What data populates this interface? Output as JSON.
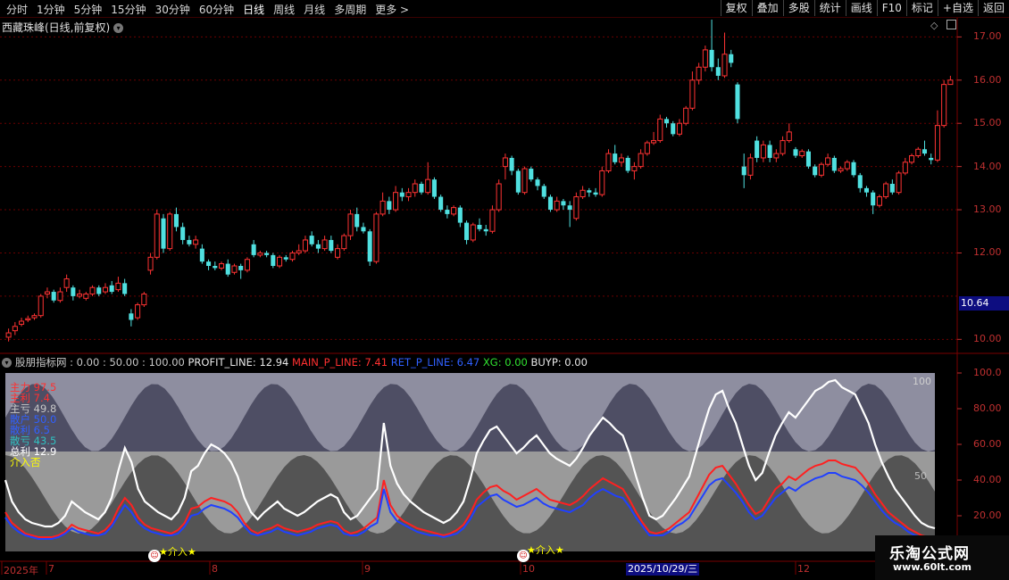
{
  "toolbar": {
    "left": [
      "分时",
      "1分钟",
      "5分钟",
      "15分钟",
      "30分钟",
      "60分钟",
      "日线",
      "周线",
      "月线",
      "多周期",
      "更多 >"
    ],
    "active": "日线",
    "right": [
      "复权",
      "叠加",
      "多股",
      "统计",
      "画线",
      "F10",
      "标记",
      "+自选",
      "返回"
    ]
  },
  "chart_title": "西藏珠峰(日线,前复权)",
  "price_axis": [
    "17.00",
    "16.00",
    "15.00",
    "14.00",
    "13.00",
    "12.00",
    "10.00"
  ],
  "current_price": "10.64",
  "indicator_header": {
    "name": "股朋指标网",
    "params": ": 0.00 : 50.00 : 100.00",
    "items": [
      {
        "text": "PROFIT_LINE: 12.94",
        "color": "#e8e8e8"
      },
      {
        "text": "MAIN_P_LINE: 7.41",
        "color": "#ff3030"
      },
      {
        "text": "RET_P_LINE: 6.47",
        "color": "#3060ff"
      },
      {
        "text": "XG: 0.00",
        "color": "#30e030"
      },
      {
        "text": "BUYP: 0.00",
        "color": "#e8e8e8"
      }
    ]
  },
  "legend": [
    {
      "text": "主力 97.5",
      "color": "#ff3030"
    },
    {
      "text": "主利 7.4",
      "color": "#ff3030"
    },
    {
      "text": "主亏 49.8",
      "color": "#c8c8c8"
    },
    {
      "text": "散户 50.0",
      "color": "#3060ff"
    },
    {
      "text": "散利 6.5",
      "color": "#3060ff"
    },
    {
      "text": "散亏 43.5",
      "color": "#30c0c0"
    },
    {
      "text": "总利 12.9",
      "color": "#ffffff"
    },
    {
      "text": "介入否",
      "color": "#ffff00"
    }
  ],
  "indicator_axis": [
    "100.0",
    "80.00",
    "60.00",
    "40.00",
    "20.00"
  ],
  "indicator_labels": {
    "top": "100",
    "mid": "50"
  },
  "signal_label": "介入",
  "date_axis": [
    "2025年",
    "7",
    "8",
    "9",
    "10",
    "12"
  ],
  "cursor_date": "2025/10/29/三",
  "watermark": {
    "name": "乐淘公式网",
    "url": "www.60lt.com"
  },
  "chart_data": {
    "type": "candlestick",
    "ylim": [
      9.8,
      17.4
    ],
    "candles": [
      [
        10.05,
        10.15,
        10.25,
        9.95
      ],
      [
        10.2,
        10.3,
        10.4,
        10.1
      ],
      [
        10.35,
        10.42,
        10.5,
        10.3
      ],
      [
        10.45,
        10.48,
        10.55,
        10.4
      ],
      [
        10.5,
        10.55,
        10.6,
        10.45
      ],
      [
        10.55,
        11.0,
        11.05,
        10.5
      ],
      [
        11.05,
        11.1,
        11.2,
        10.95
      ],
      [
        11.1,
        10.9,
        11.15,
        10.85
      ],
      [
        10.9,
        11.1,
        11.2,
        10.85
      ],
      [
        11.2,
        11.4,
        11.5,
        11.1
      ],
      [
        11.2,
        11.0,
        11.25,
        10.9
      ],
      [
        11.0,
        11.05,
        11.15,
        10.95
      ],
      [
        10.95,
        11.05,
        11.1,
        10.9
      ],
      [
        11.05,
        11.2,
        11.25,
        11.0
      ],
      [
        11.2,
        11.05,
        11.25,
        11.0
      ],
      [
        11.1,
        11.2,
        11.3,
        11.05
      ],
      [
        11.25,
        11.1,
        11.35,
        11.05
      ],
      [
        11.15,
        11.3,
        11.45,
        11.1
      ],
      [
        11.3,
        11.05,
        11.4,
        11.0
      ],
      [
        10.6,
        10.45,
        10.7,
        10.3
      ],
      [
        10.5,
        10.8,
        10.85,
        10.45
      ],
      [
        10.8,
        11.05,
        11.1,
        10.75
      ],
      [
        11.6,
        11.9,
        12.0,
        11.5
      ],
      [
        11.9,
        12.9,
        13.0,
        11.85
      ],
      [
        12.8,
        12.1,
        12.9,
        12.0
      ],
      [
        12.1,
        12.9,
        12.95,
        12.05
      ],
      [
        12.9,
        12.6,
        13.05,
        12.5
      ],
      [
        12.6,
        12.3,
        12.7,
        12.2
      ],
      [
        12.3,
        12.2,
        12.4,
        12.15
      ],
      [
        12.2,
        12.3,
        12.4,
        12.1
      ],
      [
        12.1,
        11.8,
        12.2,
        11.75
      ],
      [
        11.8,
        11.7,
        11.85,
        11.6
      ],
      [
        11.7,
        11.65,
        11.8,
        11.6
      ],
      [
        11.65,
        11.75,
        11.8,
        11.6
      ],
      [
        11.75,
        11.5,
        11.85,
        11.45
      ],
      [
        11.55,
        11.7,
        11.75,
        11.5
      ],
      [
        11.7,
        11.6,
        11.75,
        11.4
      ],
      [
        11.6,
        11.85,
        11.9,
        11.55
      ],
      [
        12.2,
        11.95,
        12.3,
        11.9
      ],
      [
        11.95,
        12.0,
        12.05,
        11.9
      ],
      [
        12.0,
        11.95,
        12.05,
        11.9
      ],
      [
        11.95,
        11.7,
        12.0,
        11.65
      ],
      [
        11.7,
        11.9,
        11.95,
        11.65
      ],
      [
        11.9,
        11.85,
        11.95,
        11.8
      ],
      [
        11.85,
        12.0,
        12.05,
        11.8
      ],
      [
        12.0,
        12.05,
        12.2,
        11.95
      ],
      [
        12.05,
        12.3,
        12.4,
        12.0
      ],
      [
        12.4,
        12.2,
        12.5,
        12.15
      ],
      [
        12.2,
        12.1,
        12.3,
        12.0
      ],
      [
        12.1,
        12.3,
        12.4,
        12.05
      ],
      [
        12.3,
        12.05,
        12.4,
        12.0
      ],
      [
        11.9,
        12.1,
        12.2,
        11.85
      ],
      [
        12.1,
        12.4,
        12.45,
        12.05
      ],
      [
        12.4,
        12.9,
        13.0,
        12.3
      ],
      [
        12.9,
        12.6,
        13.05,
        12.5
      ],
      [
        12.6,
        12.5,
        12.7,
        12.45
      ],
      [
        12.5,
        11.8,
        12.55,
        11.7
      ],
      [
        11.8,
        12.9,
        12.95,
        11.75
      ],
      [
        12.9,
        13.2,
        13.4,
        12.85
      ],
      [
        13.2,
        13.0,
        13.3,
        12.9
      ],
      [
        13.0,
        13.4,
        13.55,
        12.95
      ],
      [
        13.4,
        13.3,
        13.5,
        13.2
      ],
      [
        13.3,
        13.4,
        13.5,
        13.2
      ],
      [
        13.4,
        13.6,
        13.7,
        13.3
      ],
      [
        13.6,
        13.4,
        13.65,
        13.35
      ],
      [
        13.4,
        13.7,
        14.1,
        13.35
      ],
      [
        13.7,
        13.3,
        13.75,
        13.25
      ],
      [
        13.3,
        13.0,
        13.35,
        12.95
      ],
      [
        13.0,
        12.9,
        13.1,
        12.8
      ],
      [
        12.9,
        13.05,
        13.1,
        12.85
      ],
      [
        13.05,
        12.7,
        13.1,
        12.6
      ],
      [
        12.7,
        12.3,
        12.75,
        12.2
      ],
      [
        12.3,
        12.65,
        12.7,
        12.25
      ],
      [
        12.65,
        12.55,
        12.8,
        12.5
      ],
      [
        12.55,
        12.5,
        12.65,
        12.4
      ],
      [
        12.5,
        13.0,
        13.1,
        12.45
      ],
      [
        13.0,
        13.6,
        13.7,
        12.95
      ],
      [
        14.0,
        14.2,
        14.3,
        13.7
      ],
      [
        14.2,
        13.9,
        14.25,
        13.8
      ],
      [
        13.9,
        13.4,
        13.95,
        13.35
      ],
      [
        13.4,
        13.95,
        14.0,
        13.35
      ],
      [
        13.95,
        13.7,
        14.0,
        13.65
      ],
      [
        13.7,
        13.55,
        13.75,
        13.45
      ],
      [
        13.55,
        13.3,
        13.6,
        13.25
      ],
      [
        13.3,
        13.0,
        13.35,
        12.95
      ],
      [
        13.0,
        13.2,
        13.3,
        12.95
      ],
      [
        13.2,
        13.1,
        13.25,
        13.0
      ],
      [
        13.1,
        13.0,
        13.2,
        12.6
      ],
      [
        12.8,
        13.3,
        13.4,
        12.75
      ],
      [
        13.3,
        13.45,
        13.55,
        13.25
      ],
      [
        13.45,
        13.4,
        13.5,
        13.3
      ],
      [
        13.4,
        13.35,
        13.5,
        13.3
      ],
      [
        13.35,
        13.9,
        14.0,
        13.3
      ],
      [
        13.9,
        14.3,
        14.4,
        13.85
      ],
      [
        14.3,
        14.1,
        14.5,
        14.05
      ],
      [
        14.1,
        14.2,
        14.3,
        14.0
      ],
      [
        14.2,
        13.9,
        14.25,
        13.85
      ],
      [
        13.9,
        14.0,
        14.1,
        13.7
      ],
      [
        14.0,
        14.3,
        14.4,
        13.95
      ],
      [
        14.3,
        14.55,
        14.6,
        14.25
      ],
      [
        14.55,
        14.6,
        14.8,
        14.5
      ],
      [
        14.6,
        15.1,
        15.2,
        14.55
      ],
      [
        15.1,
        15.0,
        15.15,
        14.9
      ],
      [
        15.0,
        14.75,
        15.05,
        14.7
      ],
      [
        14.75,
        15.0,
        15.1,
        14.7
      ],
      [
        15.0,
        15.35,
        15.4,
        14.95
      ],
      [
        15.35,
        16.0,
        16.2,
        15.3
      ],
      [
        16.0,
        16.3,
        16.4,
        15.9
      ],
      [
        16.3,
        16.7,
        16.8,
        16.2
      ],
      [
        16.7,
        16.3,
        17.4,
        16.2
      ],
      [
        16.3,
        16.1,
        16.5,
        16.0
      ],
      [
        16.1,
        16.6,
        17.1,
        16.05
      ],
      [
        16.6,
        16.4,
        16.7,
        16.3
      ],
      [
        15.9,
        15.1,
        15.95,
        15.0
      ],
      [
        14.0,
        13.8,
        14.3,
        13.5
      ],
      [
        13.8,
        14.2,
        14.3,
        13.7
      ],
      [
        14.6,
        14.2,
        14.7,
        14.1
      ],
      [
        14.2,
        14.5,
        14.6,
        14.1
      ],
      [
        14.5,
        14.2,
        14.6,
        14.1
      ],
      [
        14.2,
        14.3,
        14.4,
        14.1
      ],
      [
        14.3,
        14.6,
        14.7,
        14.25
      ],
      [
        14.6,
        14.8,
        15.0,
        14.55
      ],
      [
        14.4,
        14.25,
        14.45,
        14.2
      ],
      [
        14.25,
        14.35,
        14.4,
        14.2
      ],
      [
        14.35,
        14.0,
        14.4,
        13.95
      ],
      [
        14.0,
        13.8,
        14.05,
        13.75
      ],
      [
        13.8,
        14.05,
        14.1,
        13.75
      ],
      [
        14.05,
        14.2,
        14.3,
        14.0
      ],
      [
        14.2,
        13.9,
        14.25,
        13.85
      ],
      [
        13.9,
        13.95,
        14.0,
        13.85
      ],
      [
        13.95,
        14.1,
        14.15,
        13.9
      ],
      [
        14.1,
        13.8,
        14.15,
        13.75
      ],
      [
        13.8,
        13.5,
        13.85,
        13.4
      ],
      [
        13.5,
        13.4,
        13.55,
        13.3
      ],
      [
        13.4,
        13.1,
        13.45,
        12.9
      ],
      [
        13.1,
        13.3,
        13.35,
        13.05
      ],
      [
        13.3,
        13.6,
        13.65,
        13.25
      ],
      [
        13.6,
        13.4,
        13.7,
        13.35
      ],
      [
        13.4,
        13.85,
        13.9,
        13.35
      ],
      [
        13.85,
        14.1,
        14.2,
        13.8
      ],
      [
        14.1,
        14.25,
        14.3,
        14.05
      ],
      [
        14.25,
        14.4,
        14.45,
        14.2
      ],
      [
        14.4,
        14.3,
        14.6,
        14.25
      ],
      [
        14.2,
        14.15,
        14.3,
        14.05
      ],
      [
        14.15,
        14.95,
        15.3,
        14.1
      ],
      [
        14.95,
        15.9,
        16.0,
        14.9
      ],
      [
        15.9,
        16.0,
        16.1,
        15.9
      ]
    ],
    "profit_line": [
      40,
      28,
      22,
      18,
      16,
      15,
      14,
      14,
      16,
      20,
      28,
      25,
      22,
      20,
      18,
      22,
      30,
      45,
      58,
      50,
      35,
      28,
      25,
      22,
      20,
      18,
      22,
      30,
      45,
      48,
      55,
      60,
      58,
      55,
      50,
      42,
      30,
      22,
      18,
      22,
      25,
      28,
      24,
      22,
      20,
      22,
      25,
      28,
      30,
      32,
      30,
      22,
      18,
      20,
      25,
      30,
      35,
      72,
      48,
      38,
      32,
      28,
      25,
      22,
      20,
      18,
      16,
      18,
      22,
      28,
      40,
      55,
      62,
      68,
      70,
      65,
      60,
      55,
      58,
      62,
      65,
      60,
      55,
      52,
      50,
      48,
      52,
      58,
      65,
      70,
      75,
      72,
      68,
      65,
      55,
      42,
      30,
      20,
      18,
      20,
      25,
      30,
      36,
      42,
      55,
      68,
      80,
      88,
      90,
      80,
      72,
      60,
      48,
      40,
      44,
      55,
      65,
      72,
      78,
      75,
      80,
      85,
      90,
      92,
      95,
      96,
      92,
      90,
      88,
      80,
      72,
      60,
      50,
      42,
      35,
      30,
      25,
      20,
      16,
      14,
      13
    ],
    "main_line": [
      22,
      16,
      13,
      10,
      9,
      8,
      8,
      8,
      9,
      11,
      15,
      13,
      12,
      11,
      10,
      12,
      16,
      24,
      30,
      26,
      19,
      15,
      13,
      12,
      11,
      10,
      12,
      16,
      24,
      25,
      28,
      30,
      29,
      28,
      26,
      22,
      16,
      12,
      10,
      12,
      13,
      15,
      13,
      12,
      11,
      12,
      13,
      15,
      16,
      17,
      16,
      12,
      10,
      11,
      13,
      16,
      19,
      40,
      26,
      20,
      17,
      15,
      13,
      12,
      11,
      10,
      9,
      10,
      12,
      15,
      21,
      29,
      33,
      36,
      37,
      34,
      32,
      29,
      31,
      33,
      35,
      32,
      29,
      28,
      27,
      26,
      28,
      31,
      35,
      38,
      41,
      39,
      37,
      35,
      29,
      22,
      16,
      11,
      10,
      11,
      13,
      16,
      19,
      22,
      29,
      36,
      43,
      47,
      48,
      43,
      38,
      32,
      26,
      21,
      23,
      29,
      35,
      38,
      42,
      40,
      43,
      46,
      48,
      49,
      51,
      51,
      49,
      48,
      47,
      43,
      38,
      32,
      27,
      22,
      19,
      16,
      13,
      11,
      9,
      8,
      7
    ],
    "retail_line": [
      19,
      14,
      11,
      9,
      8,
      7,
      7,
      7,
      8,
      10,
      13,
      11,
      10,
      9,
      9,
      10,
      14,
      20,
      26,
      22,
      16,
      13,
      11,
      10,
      9,
      9,
      10,
      14,
      20,
      21,
      24,
      26,
      25,
      24,
      22,
      19,
      14,
      10,
      9,
      10,
      11,
      13,
      11,
      10,
      9,
      10,
      11,
      13,
      14,
      15,
      14,
      10,
      9,
      9,
      11,
      14,
      16,
      35,
      22,
      17,
      15,
      13,
      11,
      10,
      9,
      9,
      8,
      9,
      10,
      13,
      18,
      25,
      28,
      31,
      32,
      29,
      27,
      25,
      26,
      28,
      30,
      27,
      25,
      24,
      23,
      22,
      24,
      26,
      30,
      33,
      35,
      33,
      31,
      30,
      25,
      19,
      14,
      9,
      9,
      9,
      11,
      14,
      16,
      19,
      25,
      31,
      37,
      40,
      41,
      37,
      33,
      28,
      22,
      18,
      20,
      25,
      30,
      33,
      36,
      34,
      37,
      39,
      41,
      42,
      44,
      44,
      42,
      41,
      40,
      37,
      33,
      28,
      23,
      19,
      16,
      14,
      11,
      9,
      8,
      7,
      6
    ]
  }
}
